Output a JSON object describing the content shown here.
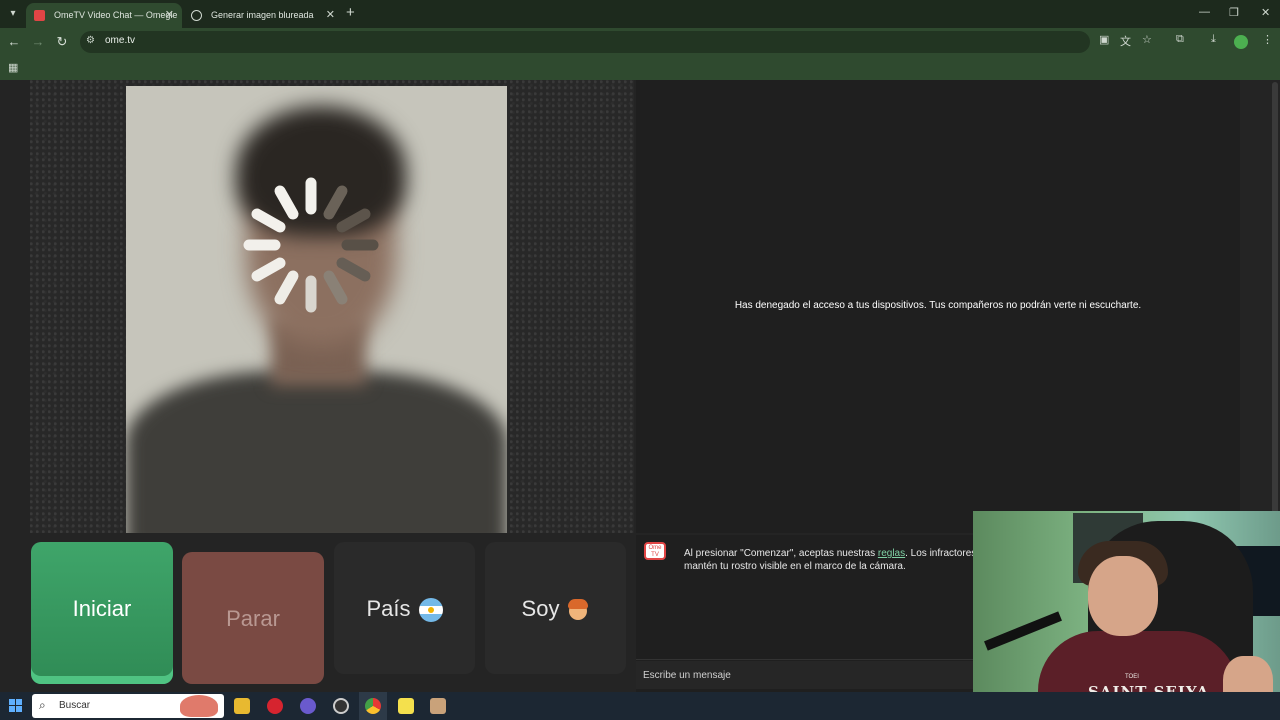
{
  "browser": {
    "tabs": [
      {
        "title": "OmeTV Video Chat — Omegle",
        "active": true
      },
      {
        "title": "Generar imagen blureada",
        "active": false
      }
    ],
    "url": "ome.tv"
  },
  "page": {
    "denied_message": "Has denegado el acceso a tus dispositivos. Tus compañeros no podrán verte ni escucharte.",
    "buttons": {
      "start": "Iniciar",
      "stop": "Parar",
      "country": "País",
      "iam": "Soy"
    },
    "chat": {
      "logo_text": "Ome TV",
      "rules_before": "Al presionar \"Comenzar\", aceptas nuestras ",
      "rules_link": "reglas",
      "rules_after": ". Los infractores",
      "rules_line2": "mantén tu rostro visible en el marco de la cámara.",
      "input_placeholder": "Escribe un mensaje"
    }
  },
  "webcam": {
    "shirt_text": "SAINT SEIYA",
    "shirt_sub": "TOEI"
  },
  "taskbar": {
    "search_label": "Buscar"
  },
  "colors": {
    "accent_green": "#3fa56a",
    "stop_red": "#7a4a43",
    "link": "#7fd2a5",
    "chrome_green": "#2f4a2f"
  }
}
